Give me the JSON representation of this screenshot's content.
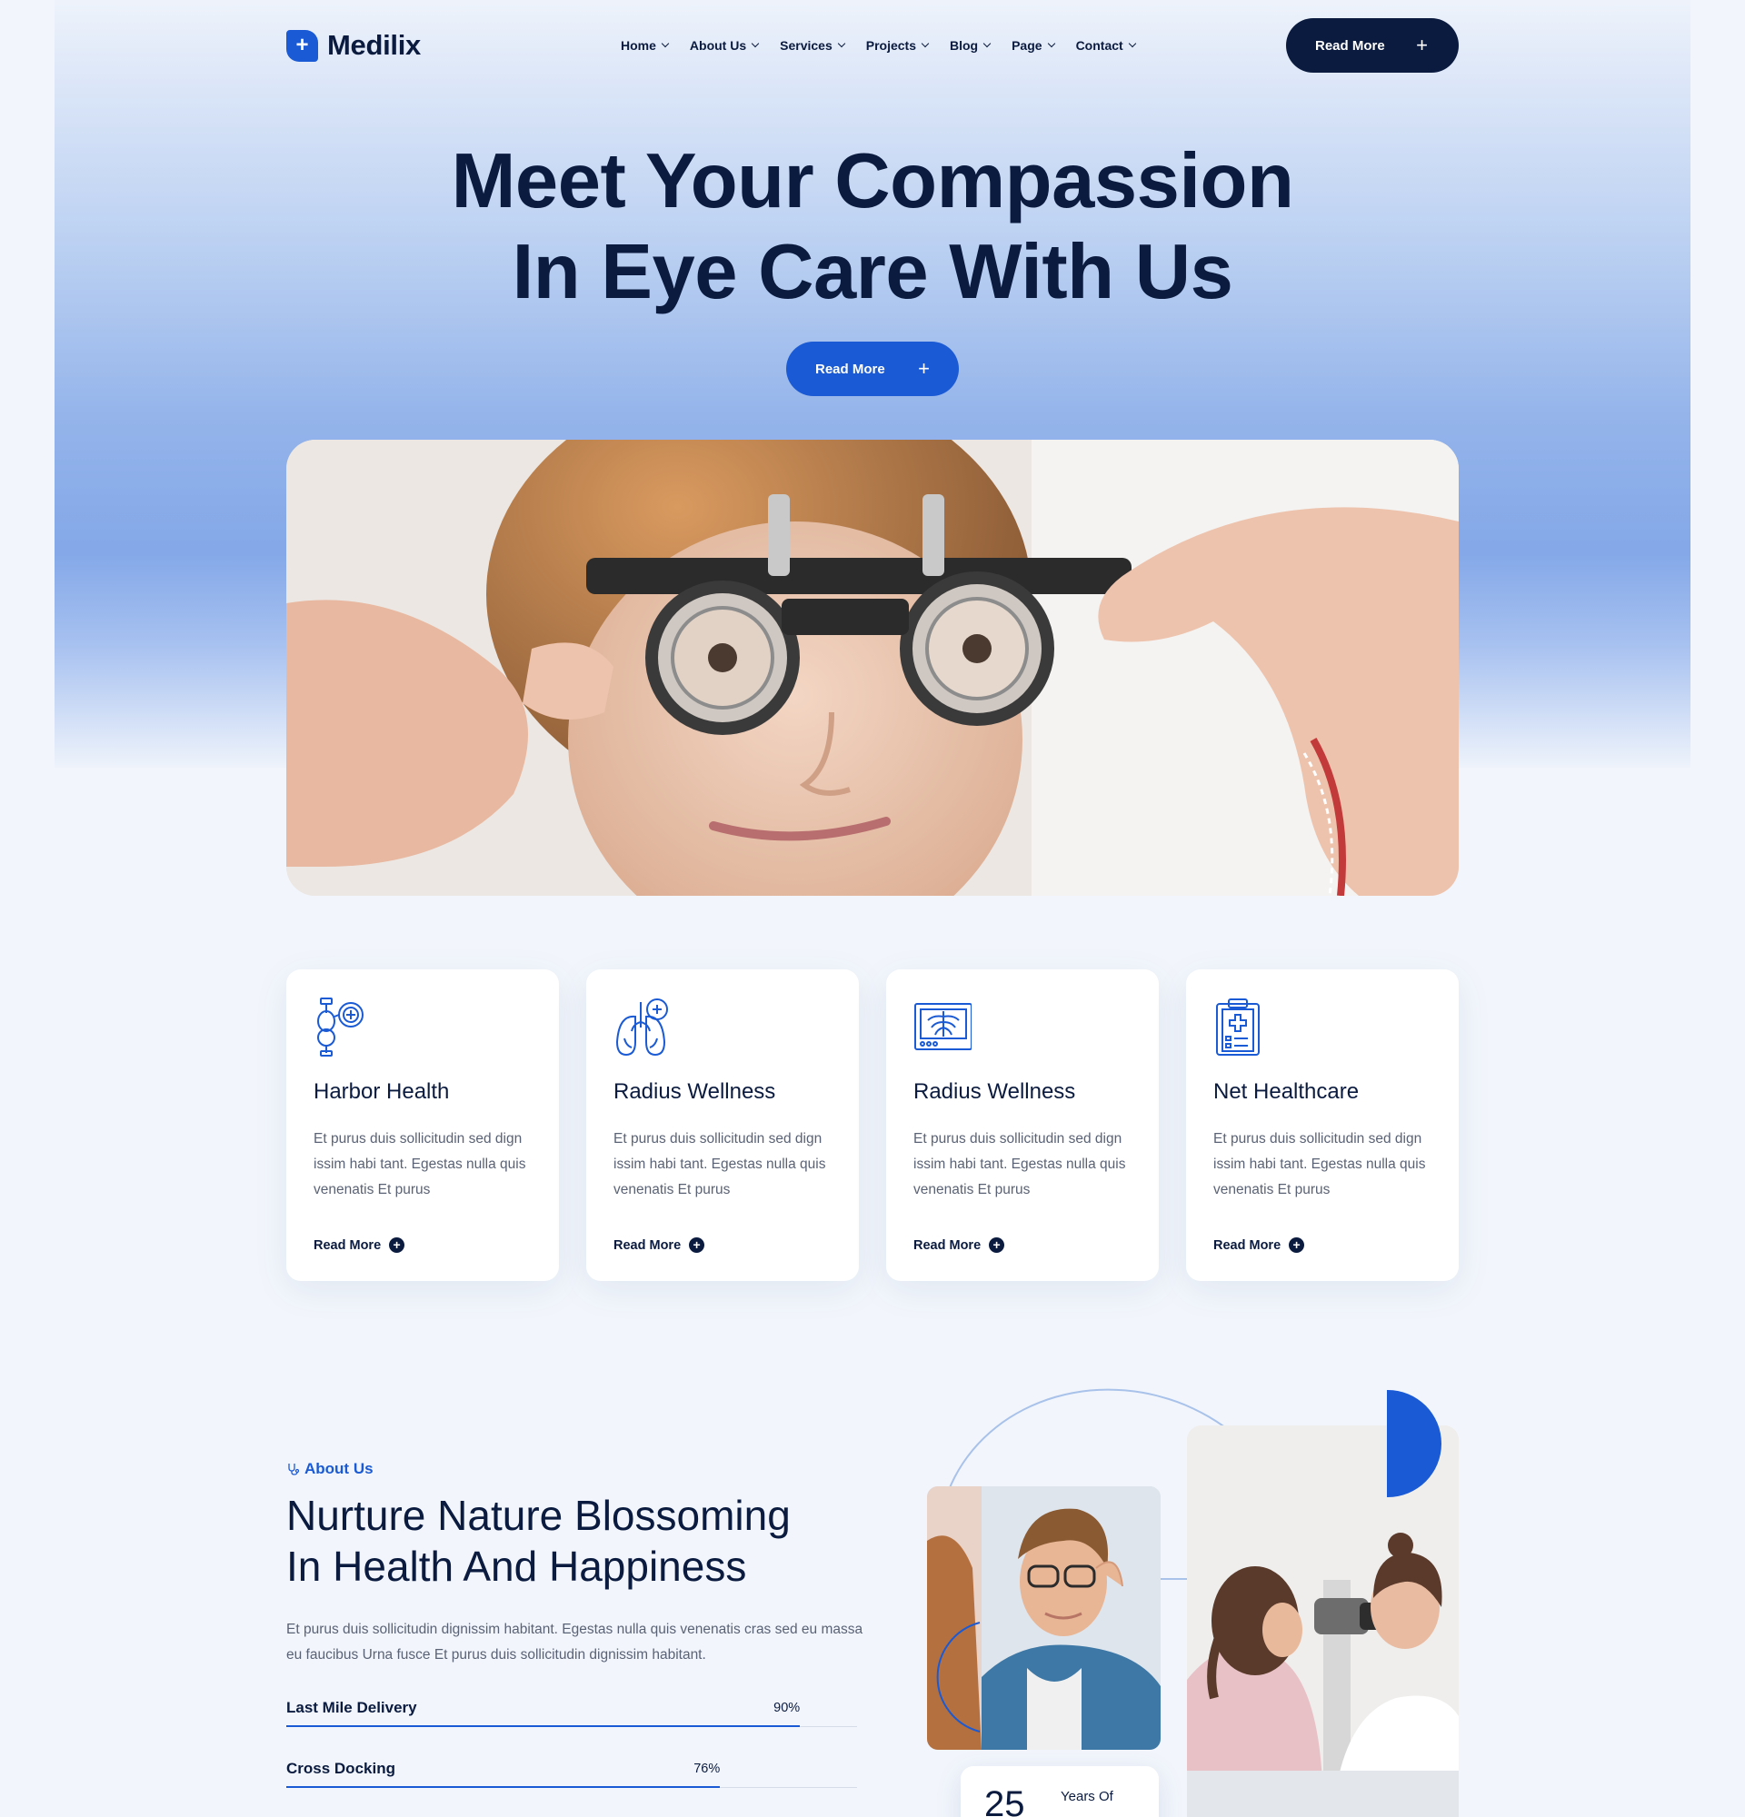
{
  "brand": {
    "name": "Medilix",
    "logo_glyph": "+",
    "accent": "#1a5ad4",
    "dark": "#0b1b3f"
  },
  "nav": {
    "items": [
      {
        "label": "Home"
      },
      {
        "label": "About Us"
      },
      {
        "label": "Services"
      },
      {
        "label": "Projects"
      },
      {
        "label": "Blog"
      },
      {
        "label": "Page"
      },
      {
        "label": "Contact"
      }
    ],
    "cta_label": "Read More",
    "cta_icon": "+"
  },
  "hero": {
    "title_line1": "Meet Your Compassion",
    "title_line2": "In Eye Care With Us",
    "cta_label": "Read More",
    "cta_icon": "+"
  },
  "services": [
    {
      "icon": "kidney-icon",
      "title": "Harbor Health",
      "text": "Et purus duis sollicitudin sed dign issim habi tant. Egestas nulla quis venenatis Et purus",
      "link": "Read More"
    },
    {
      "icon": "lungs-icon",
      "title": "Radius Wellness",
      "text": "Et purus duis sollicitudin sed dign issim habi tant. Egestas nulla quis venenatis Et purus",
      "link": "Read More"
    },
    {
      "icon": "xray-monitor-icon",
      "title": "Radius Wellness",
      "text": "Et purus duis sollicitudin sed dign issim habi tant. Egestas nulla quis venenatis Et purus",
      "link": "Read More"
    },
    {
      "icon": "clipboard-medical-icon",
      "title": "Net Healthcare",
      "text": "Et purus duis sollicitudin sed dign issim habi tant. Egestas nulla quis venenatis Et purus",
      "link": "Read More"
    }
  ],
  "about": {
    "tag": "About Us",
    "title_line1": "Nurture Nature Blossoming",
    "title_line2": "In Health And Happiness",
    "text": "Et purus duis sollicitudin dignissim habitant. Egestas nulla quis venenatis cras sed eu massa eu faucibus Urna fusce Et purus duis sollicitudin dignissim habitant.",
    "skills": [
      {
        "name": "Last Mile Delivery",
        "percent_label": "90%",
        "value": 0.9
      },
      {
        "name": "Cross Docking",
        "percent_label": "76%",
        "value": 0.76
      }
    ],
    "experience": {
      "number": "25",
      "label": "Years Of"
    }
  }
}
